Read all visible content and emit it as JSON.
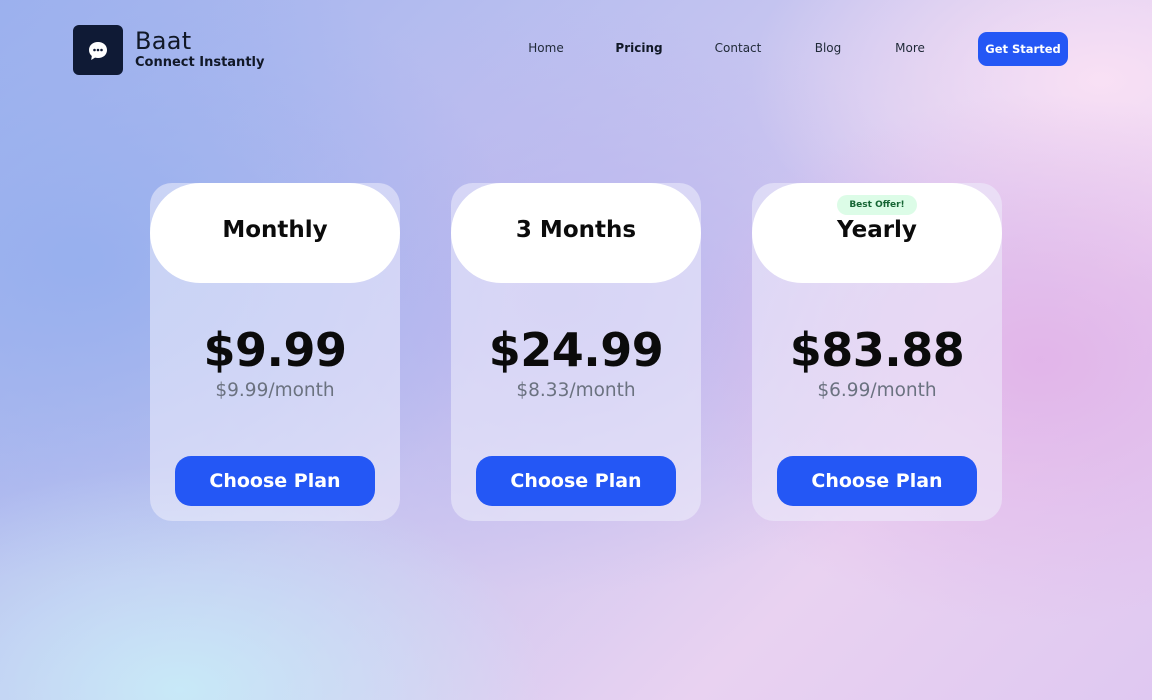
{
  "brand": {
    "name": "Baat",
    "tagline": "Connect Instantly",
    "logo_icon": "chat-bubble-icon"
  },
  "nav": {
    "items": [
      {
        "label": "Home",
        "active": false
      },
      {
        "label": "Pricing",
        "active": true
      },
      {
        "label": "Contact",
        "active": false
      },
      {
        "label": "Blog",
        "active": false
      },
      {
        "label": "More",
        "active": false
      }
    ],
    "cta_label": "Get Started"
  },
  "plans": [
    {
      "name": "Monthly",
      "price": "$9.99",
      "per_month": "$9.99/month",
      "button_label": "Choose Plan"
    },
    {
      "name": "3 Months",
      "price": "$24.99",
      "per_month": "$8.33/month",
      "button_label": "Choose Plan"
    },
    {
      "name": "Yearly",
      "badge": "Best Offer!",
      "price": "$83.88",
      "per_month": "$6.99/month",
      "button_label": "Choose Plan"
    }
  ],
  "colors": {
    "accent": "#2457f5",
    "logo_bg": "#0f1a35",
    "badge_bg": "#dcfce7",
    "badge_text": "#166534"
  }
}
